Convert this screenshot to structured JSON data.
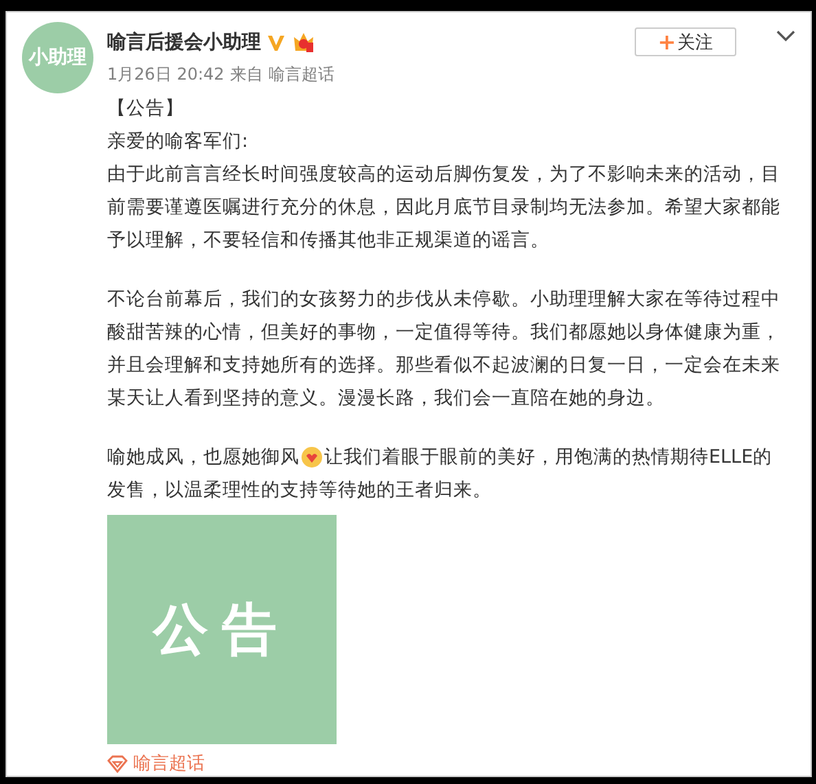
{
  "post": {
    "avatar_text": "小助理",
    "author": "喻言后援会小助理",
    "verified": true,
    "follow_button": "关注",
    "follow_plus": "+",
    "time": "1月26日 20:42",
    "source_prefix": "来自",
    "source": "喻言超话"
  },
  "content": {
    "heading": "【公告】",
    "greeting": "亲爱的喻客军们:",
    "paragraphs": [
      "由于此前言言经长时间强度较高的运动后脚伤复发，为了不影响未来的活动，目前需要谨遵医嘱进行充分的休息，因此月底节目录制均无法参加。希望大家都能予以理解，不要轻信和传播其他非正规渠道的谣言。",
      "不论台前幕后，我们的女孩努力的步伐从未停歇。小助理理解大家在等待过程中酸甜苦辣的心情，但美好的事物，一定值得等待。我们都愿她以身体健康为重，并且会理解和支持她所有的选择。那些看似不起波澜的日复一日，一定会在未来某天让人看到坚持的意义。漫漫长路，我们会一直陪在她的身边。"
    ],
    "last_paragraph_before": "喻她成风，也愿她御风",
    "last_paragraph_after": "让我们着眼于眼前的美好，用饱满的热情期待ELLE的",
    "last_paragraph_line2": "发售，以温柔理性的支持等待她的王者归来。"
  },
  "image": {
    "text": "公告"
  },
  "topic_tag": "喻言超话"
}
